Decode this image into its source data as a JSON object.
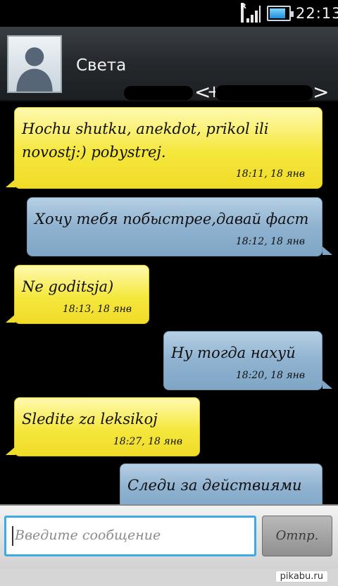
{
  "status_bar": {
    "roaming_indicator": "R",
    "time": "22:13",
    "battery_color": "#1f8ed8"
  },
  "header": {
    "contact_name_visible": "Света",
    "number_prefix_visible": "+",
    "open_bracket": "<",
    "close_bracket": ">"
  },
  "messages": [
    {
      "direction": "incoming",
      "text": "Hochu shutku, anekdot, prikol ili novostj:) pobystrej.",
      "time": "18:11, 18 янв"
    },
    {
      "direction": "outgoing",
      "text": "Хочу тебя побыстрее,давай фаст",
      "time": "18:12, 18 янв"
    },
    {
      "direction": "incoming",
      "text": "Ne goditsja)",
      "time": "18:13, 18 янв"
    },
    {
      "direction": "outgoing",
      "text": "Ну тогда нахуй",
      "time": "18:20, 18 янв"
    },
    {
      "direction": "incoming",
      "text": "Sledite za leksikoj",
      "time": "18:27, 18 янв"
    },
    {
      "direction": "outgoing",
      "text": "Следи за действиями",
      "time": ""
    }
  ],
  "composer": {
    "placeholder": "Введите сообщение",
    "send_label": "Отпр."
  },
  "watermark": "pikabu.ru",
  "colors": {
    "incoming_bubble": "#f5e73d",
    "outgoing_bubble": "#8fb2d0",
    "input_focus": "#3fa8e6"
  }
}
